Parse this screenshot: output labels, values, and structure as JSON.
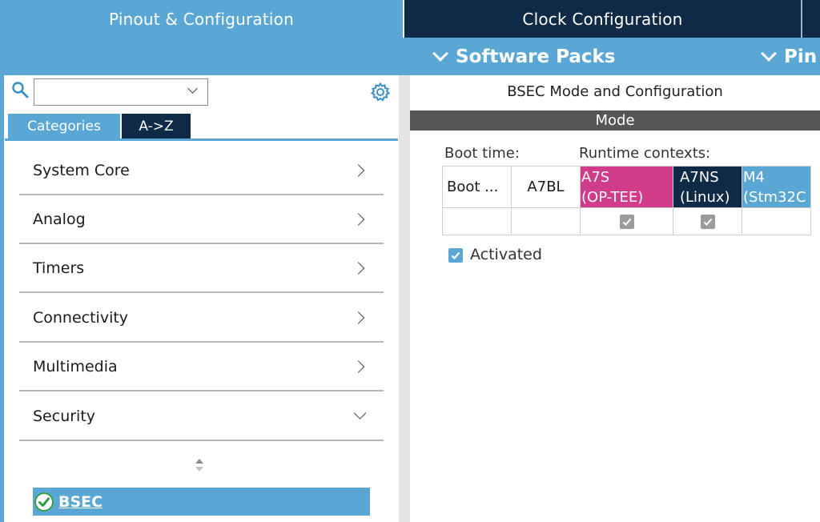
{
  "tabs": {
    "pinout": "Pinout & Configuration",
    "clock": "Clock Configuration"
  },
  "subbar": {
    "software_packs": "Software Packs",
    "pinout_short": "Pin"
  },
  "left": {
    "search_value": "",
    "tab_categories": "Categories",
    "tab_az": "A->Z",
    "categories": [
      "System Core",
      "Analog",
      "Timers",
      "Connectivity",
      "Multimedia",
      "Security"
    ],
    "selected_item": "BSEC"
  },
  "right": {
    "title": "BSEC Mode and Configuration",
    "mode_header": "Mode",
    "boot_time_label": "Boot time:",
    "runtime_label": "Runtime contexts:",
    "columns": {
      "boot": "Boot ...",
      "a7bl": "A7BL",
      "a7s": "A7S",
      "a7s_sub": "(OP-TEE)",
      "a7ns": "A7NS",
      "a7ns_sub": "(Linux)",
      "m4": "M4",
      "m4_sub": "(Stm32C"
    },
    "activated_label": "Activated"
  },
  "colors": {
    "accent": "#5aa7d6",
    "navy": "#0e2a47",
    "magenta": "#d13c8a",
    "mode_bar": "#555555"
  }
}
